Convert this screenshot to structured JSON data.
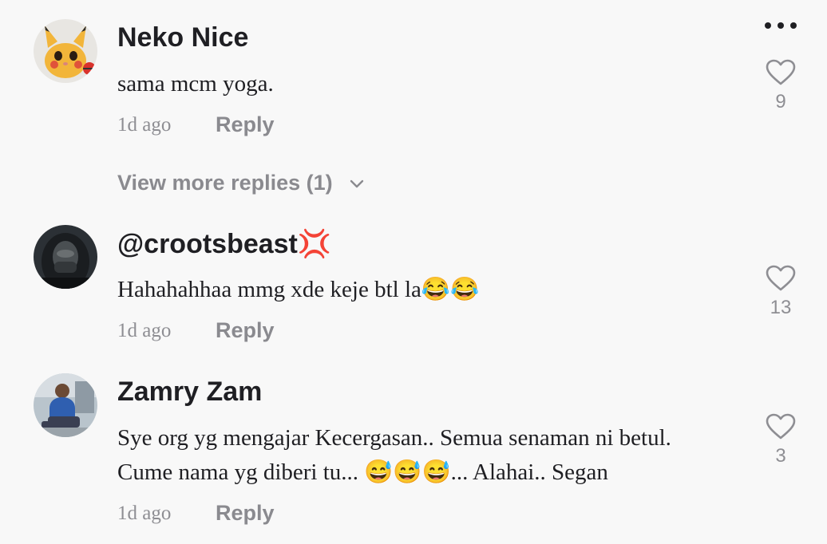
{
  "comments": [
    {
      "author": "Neko Nice",
      "text": "sama mcm yoga.",
      "time": "1d ago",
      "reply_label": "Reply",
      "likes": "9",
      "avatar_icon": "pikachu-cat-avatar"
    },
    {
      "author": "@crootsbeast💢",
      "text": "Hahahahhaa mmg xde keje btl la😂😂",
      "time": "1d ago",
      "reply_label": "Reply",
      "likes": "13",
      "avatar_icon": "hooded-figure-avatar"
    },
    {
      "author": "Zamry Zam",
      "text_line1": "Sye org yg mengajar Kecergasan.. Semua senaman ni betul.",
      "text_line2": "Cume nama yg diberi tu... 😅😅😅... Alahai.. Segan",
      "time": "1d ago",
      "reply_label": "Reply",
      "likes": "3",
      "avatar_icon": "person-photo-avatar"
    }
  ],
  "view_more_replies": "View more replies (1)",
  "icons": {
    "like": "heart-outline-icon",
    "more": "more-dots-icon",
    "expand": "chevron-down-icon"
  },
  "colors": {
    "background": "#f8f8f8",
    "text_primary": "#1f1f23",
    "text_secondary": "#8e8e93"
  }
}
